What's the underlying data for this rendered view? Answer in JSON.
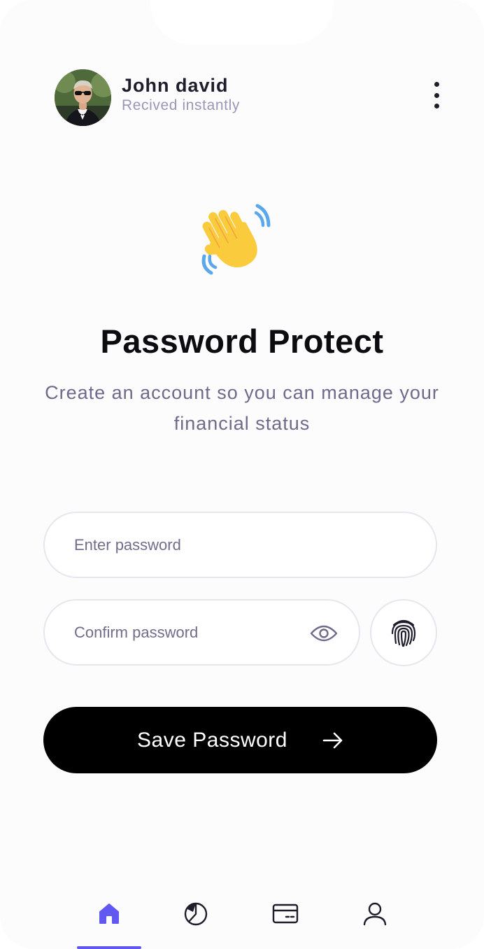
{
  "header": {
    "user_name": "John david",
    "user_status": "Recived instantly",
    "more_icon": "vertical-dots-icon"
  },
  "hero": {
    "emoji_icon": "waving-hand-icon",
    "title": "Password Protect",
    "subtitle": "Create an account so you can manage your financial status"
  },
  "form": {
    "password_placeholder": "Enter password",
    "password_value": "",
    "confirm_placeholder": "Confirm password",
    "confirm_value": "",
    "eye_icon": "eye-icon",
    "fingerprint_icon": "fingerprint-icon",
    "save_label": "Save Password",
    "save_icon": "arrow-right-icon"
  },
  "nav": {
    "items": [
      {
        "icon": "home-icon",
        "active": true
      },
      {
        "icon": "pie-chart-icon",
        "active": false
      },
      {
        "icon": "card-icon",
        "active": false
      },
      {
        "icon": "user-icon",
        "active": false
      }
    ]
  },
  "colors": {
    "accent": "#6158f2",
    "button_bg": "#000000",
    "muted_text": "#6e6a8c",
    "border": "#e7e6ef"
  }
}
